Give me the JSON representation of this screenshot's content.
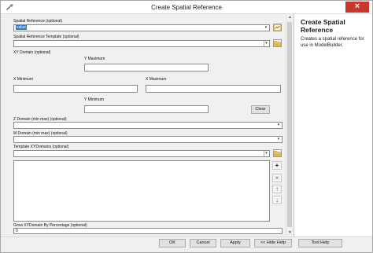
{
  "window": {
    "title": "Create Spatial Reference",
    "close_glyph": "×",
    "icon": "toolbox-icon"
  },
  "form": {
    "spatial_reference": {
      "label": "Spatial Reference (optional)",
      "value": "value"
    },
    "spatial_reference_template": {
      "label": "Spatial Reference Template (optional)",
      "value": ""
    },
    "xy_domain": {
      "label": "XY Domain (optional)",
      "y_maximum_label": "Y Maximum",
      "x_minimum_label": "X Minimum",
      "x_maximum_label": "X Maximum",
      "y_minimum_label": "Y Minimum",
      "clear_label": "Clear"
    },
    "z_domain": {
      "label": "Z Domain (min max) (optional)",
      "value": ""
    },
    "m_domain": {
      "label": "M Domain (min max) (optional)",
      "value": ""
    },
    "template_xydomains": {
      "label": "Template XYDomains (optional)",
      "value": "",
      "items": []
    },
    "grow_xydomain": {
      "label": "Grow XYDomain By Percentage (optional)",
      "value": "0"
    }
  },
  "list_buttons": {
    "add": "+",
    "remove": "×",
    "up": "↑",
    "down": "↓"
  },
  "help_panel": {
    "title": "Create Spatial Reference",
    "body": "Creates a spatial reference for use in ModelBuilder."
  },
  "footer": {
    "ok": "OK",
    "cancel": "Cancel",
    "apply": "Apply",
    "hide_help": "<< Hide Help",
    "tool_help": "Tool Help"
  },
  "scrollbar": {
    "up": "▲",
    "down": "▼"
  },
  "colors": {
    "selection": "#3377d6",
    "close_button": "#c7372b",
    "folder_icon": "#e8b93a",
    "add_icon": "#1a1a1a"
  }
}
